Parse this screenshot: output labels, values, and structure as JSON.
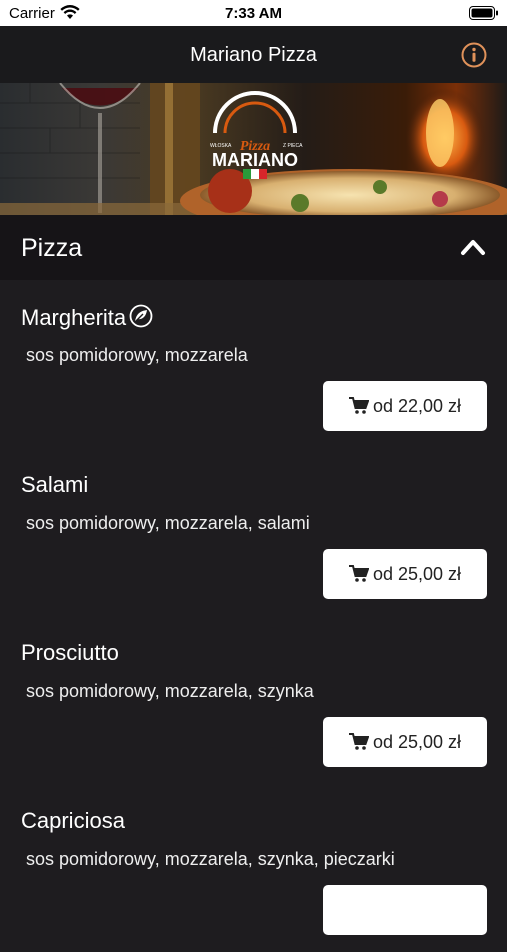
{
  "status": {
    "carrier": "Carrier",
    "time": "7:33 AM"
  },
  "nav": {
    "title": "Mariano Pizza"
  },
  "hero": {
    "logo_top": "WŁOSKA",
    "logo_top_right": "Z PIECA",
    "logo_script": "Pizza",
    "logo_name": "MARIANO"
  },
  "section": {
    "title": "Pizza"
  },
  "items": [
    {
      "name": "Margherita",
      "vegan": true,
      "description": "sos pomidorowy, mozzarela",
      "price": "od 22,00 zł"
    },
    {
      "name": "Salami",
      "vegan": false,
      "description": "sos pomidorowy, mozzarela, salami",
      "price": "od 25,00 zł"
    },
    {
      "name": "Prosciutto",
      "vegan": false,
      "description": "sos pomidorowy, mozzarela, szynka",
      "price": "od 25,00 zł"
    },
    {
      "name": "Capriciosa",
      "vegan": false,
      "description": "sos pomidorowy, mozzarela, szynka, pieczarki",
      "price": ""
    }
  ],
  "colors": {
    "accent": "#e0925a",
    "background": "#1e1c1f",
    "header": "#161417",
    "navbar": "#1a1a1c"
  }
}
